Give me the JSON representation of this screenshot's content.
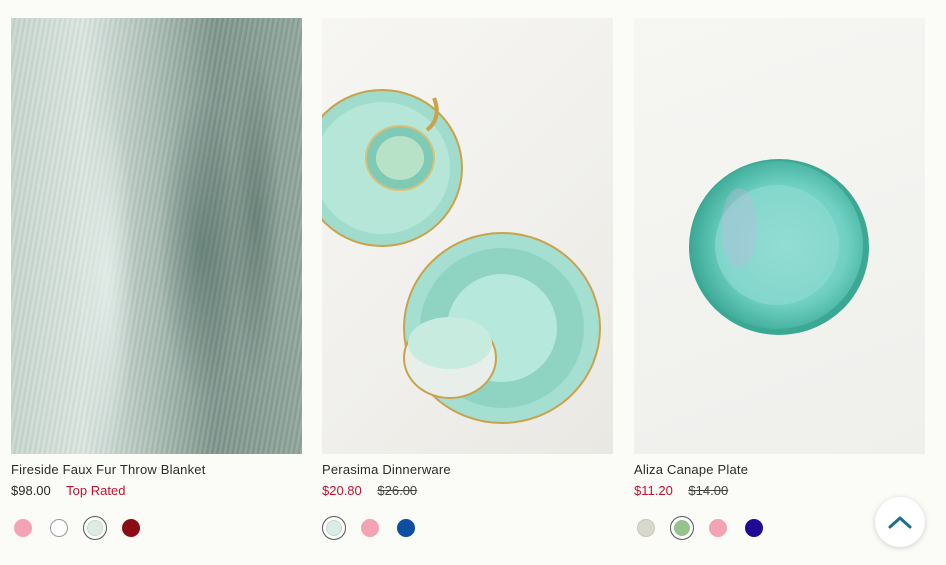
{
  "products": [
    {
      "title": "Fireside Faux Fur Throw Blanket",
      "price": "$98.00",
      "badge": "Top Rated",
      "swatches": [
        {
          "color": "#f4a3b4",
          "selected": false
        },
        {
          "color": "#ffffff",
          "selected": false
        },
        {
          "color": "#dcebe4",
          "selected": true
        },
        {
          "color": "#8a0b13",
          "selected": false
        }
      ]
    },
    {
      "title": "Perasima Dinnerware",
      "sale_price": "$20.80",
      "original_price": "$26.00",
      "swatches": [
        {
          "color": "#d9ece6",
          "selected": true
        },
        {
          "color": "#f4a3b4",
          "selected": false
        },
        {
          "color": "#0c4fa3",
          "selected": false
        }
      ]
    },
    {
      "title": "Aliza Canape Plate",
      "sale_price": "$11.20",
      "original_price": "$14.00",
      "swatches": [
        {
          "color": "#d8d8cc",
          "selected": false
        },
        {
          "color": "#96c28c",
          "selected": true
        },
        {
          "color": "#f4a3b4",
          "selected": false
        },
        {
          "color": "#1f0a96",
          "selected": false
        }
      ]
    }
  ],
  "colors": {
    "sale": "#c8102e",
    "accent": "#1d6f8f"
  },
  "icons": {
    "scroll_top": "chevron-up-icon"
  }
}
